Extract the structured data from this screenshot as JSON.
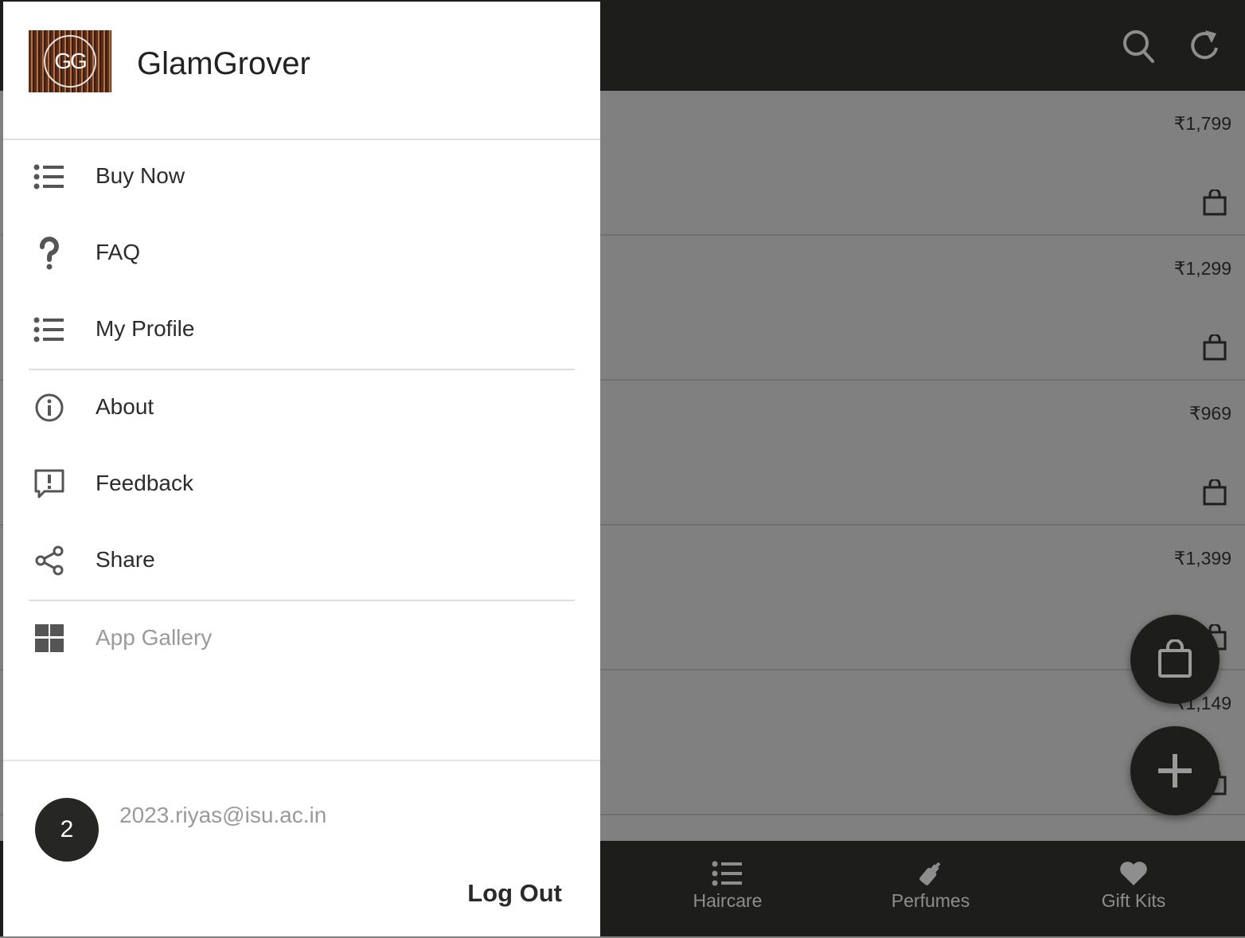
{
  "drawer": {
    "app_name": "GlamGrover",
    "logo_text": "GG",
    "menu": [
      {
        "label": "Buy Now",
        "icon": "list-icon"
      },
      {
        "label": "FAQ",
        "icon": "question-mark-icon"
      },
      {
        "label": "My Profile",
        "icon": "list-icon"
      },
      {
        "label": "About",
        "icon": "info-icon"
      },
      {
        "label": "Feedback",
        "icon": "feedback-icon"
      },
      {
        "label": "Share",
        "icon": "share-icon"
      },
      {
        "label": "App Gallery",
        "icon": "app-gallery-icon",
        "disabled": true
      }
    ],
    "user": {
      "avatar_text": "2",
      "email": "2023.riyas@isu.ac.in"
    },
    "logout_label": "Log Out"
  },
  "topbar": {
    "icons": [
      "search-icon",
      "refresh-icon"
    ]
  },
  "products": [
    {
      "price": "₹1,799"
    },
    {
      "price": "₹1,299"
    },
    {
      "price": "₹969"
    },
    {
      "price": "₹1,399"
    },
    {
      "price": "₹1,149"
    }
  ],
  "bottom_nav": [
    {
      "label": "Haircare",
      "icon": "list-icon"
    },
    {
      "label": "Perfumes",
      "icon": "perfume-bottle-icon"
    },
    {
      "label": "Gift Kits",
      "icon": "heart-icon"
    }
  ],
  "fabs": [
    "cart-bag-icon",
    "add-icon"
  ],
  "colors": {
    "dark_bar": "#1d1d1b",
    "scrim": "#808080",
    "drawer_bg": "#ffffff",
    "muted_text": "#9a9a9a"
  }
}
